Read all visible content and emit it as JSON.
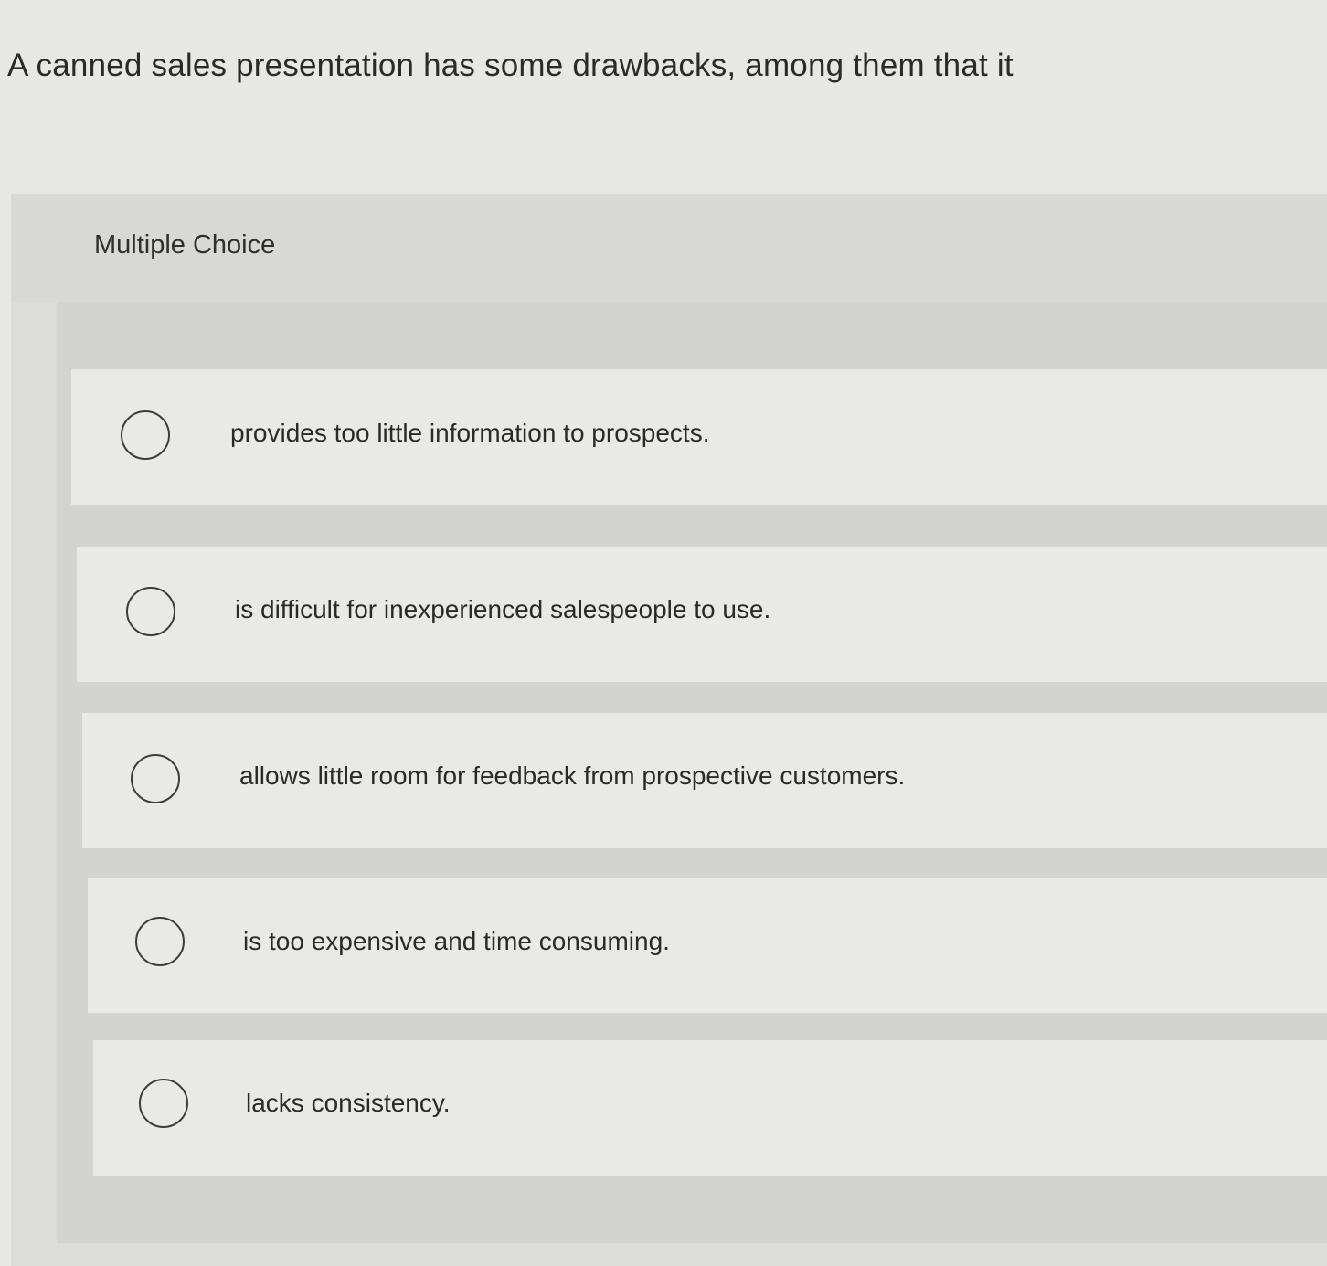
{
  "question": {
    "text": "A canned sales presentation has some drawbacks, among them that it"
  },
  "question_type": "Multiple Choice",
  "options": [
    {
      "label": "provides too little information to prospects.",
      "selected": false
    },
    {
      "label": "is difficult for inexperienced salespeople to use.",
      "selected": false
    },
    {
      "label": "allows little room for feedback from prospective customers.",
      "selected": false
    },
    {
      "label": "is too expensive and time consuming.",
      "selected": false
    },
    {
      "label": "lacks consistency.",
      "selected": false
    }
  ]
}
